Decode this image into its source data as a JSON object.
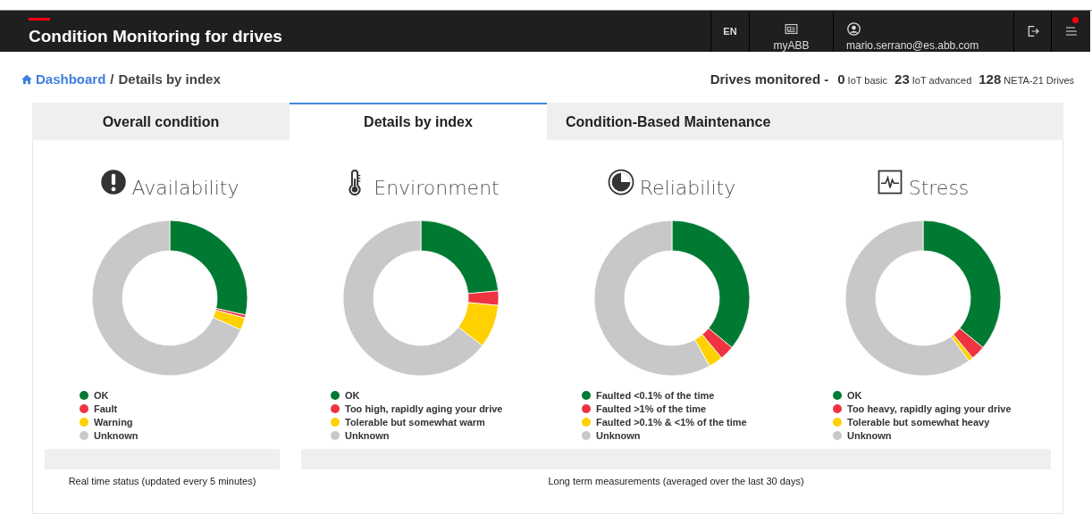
{
  "header": {
    "title": "Condition Monitoring for drives",
    "language": "EN",
    "portal_link": "myABB",
    "user": "mario.serrano@es.abb.com",
    "notification": true
  },
  "breadcrumb": {
    "home": "Dashboard",
    "separator": "/",
    "current": "Details by index"
  },
  "drives_monitored": {
    "label": "Drives monitored -",
    "counts": [
      "**0** IoT basic",
      "**23** IoT advanced",
      "**128** NETA-21 Drives"
    ]
  },
  "tabs": [
    {
      "label": "Overall condition",
      "selected": false
    },
    {
      "label": "Details by index",
      "selected": true
    },
    {
      "label": "Condition-Based Maintenance",
      "selected": false
    }
  ],
  "indexes": [
    {
      "kind": "availability",
      "title": "Availability",
      "legend": [
        {
          "label": "OK",
          "color": "#007a33"
        },
        {
          "label": "Fault",
          "color": "#ef3340"
        },
        {
          "label": "Warning",
          "color": "#ffd100"
        },
        {
          "label": "Unknown",
          "color": "#c8c8c8"
        }
      ]
    },
    {
      "kind": "environment",
      "title": "Environment",
      "legend": [
        {
          "label": "OK",
          "color": "#007a33"
        },
        {
          "label": "Too high, rapidly aging your drive",
          "color": "#ef3340"
        },
        {
          "label": "Tolerable but somewhat warm",
          "color": "#ffd100"
        },
        {
          "label": "Unknown",
          "color": "#c8c8c8"
        }
      ]
    },
    {
      "kind": "reliability",
      "title": "Reliability",
      "legend": [
        {
          "label": "Faulted <0.1% of the time",
          "color": "#007a33"
        },
        {
          "label": "Faulted >1% of the time",
          "color": "#ef3340"
        },
        {
          "label": "Faulted >0.1% & <1% of the time",
          "color": "#ffd100"
        },
        {
          "label": "Unknown",
          "color": "#c8c8c8"
        }
      ]
    },
    {
      "kind": "stress",
      "title": "Stress",
      "legend": [
        {
          "label": "OK",
          "color": "#007a33"
        },
        {
          "label": "Too heavy, rapidly aging your drive",
          "color": "#ef3340"
        },
        {
          "label": "Tolerable but somewhat heavy",
          "color": "#ffd100"
        },
        {
          "label": "Unknown",
          "color": "#c8c8c8"
        }
      ]
    }
  ],
  "footers": [
    "Real time status (updated every 5 minutes)",
    "Long term measurements (averaged over the last 30 days)"
  ]
}
